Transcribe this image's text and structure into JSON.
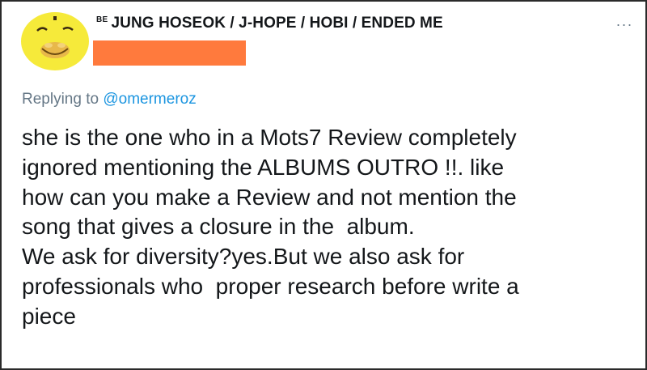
{
  "author": {
    "prefix": "BE",
    "display_name": "JUNG HOSEOK / J-HOPE / HOBI / ENDED ME"
  },
  "reply": {
    "label": "Replying to",
    "mention": "@omermeroz"
  },
  "tweet": {
    "lines": [
      "she is the one who in a Mots7 Review completely",
      "ignored mentioning the ALBUMS OUTRO !!. like",
      "how can you make a Review and not mention the",
      "song that gives a closure in the  album.",
      "We ask for diversity?yes.But we also ask for",
      "professionals who  proper research before write a",
      "piece"
    ]
  },
  "more_menu": {
    "label": "···"
  },
  "colors": {
    "handle_redaction": "#ff7a3d",
    "avatar_yellow": "#f6ea3a",
    "link_blue": "#1b95e0",
    "muted_gray": "#657786"
  },
  "icons": {
    "avatar": "emoji-face-avatar",
    "more": "more-dots-icon"
  }
}
